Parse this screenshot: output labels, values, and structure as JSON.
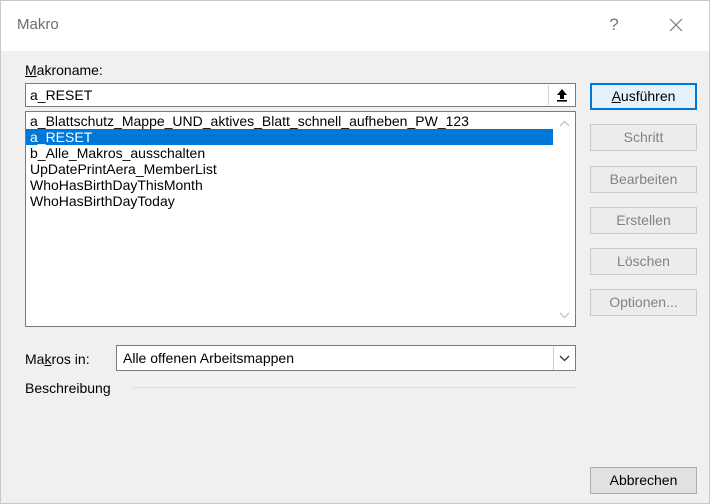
{
  "window": {
    "title": "Makro",
    "help_glyph": "?"
  },
  "macro_name": {
    "label_accel": "M",
    "label_rest": "akroname:",
    "value": "a_RESET"
  },
  "macro_list": {
    "items": [
      "a_Blattschutz_Mappe_UND_aktives_Blatt_schnell_aufheben_PW_123",
      "a_RESET",
      "b_Alle_Makros_ausschalten",
      "UpDatePrintAera_MemberList",
      "WhoHasBirthDayThisMonth",
      "WhoHasBirthDayToday"
    ],
    "selected_index": 1
  },
  "buttons": {
    "run_accel": "A",
    "run_rest": "usführen",
    "step": "Schritt",
    "edit": "Bearbeiten",
    "create": "Erstellen",
    "delete": "Löschen",
    "options": "Optionen...",
    "cancel": "Abbrechen"
  },
  "macros_in": {
    "label_pre": "Ma",
    "label_accel": "k",
    "label_post": "ros in:",
    "value": "Alle offenen Arbeitsmappen"
  },
  "description": {
    "label": "Beschreibung"
  },
  "icons": {
    "up": "arrow-up-bar-icon",
    "close": "close-icon",
    "scroll_up": "chevron-up-icon",
    "scroll_down": "chevron-down-icon",
    "dropdown": "chevron-down-icon"
  },
  "colors": {
    "selection": "#0078d7",
    "dialog_bg": "#f0f0f0"
  }
}
